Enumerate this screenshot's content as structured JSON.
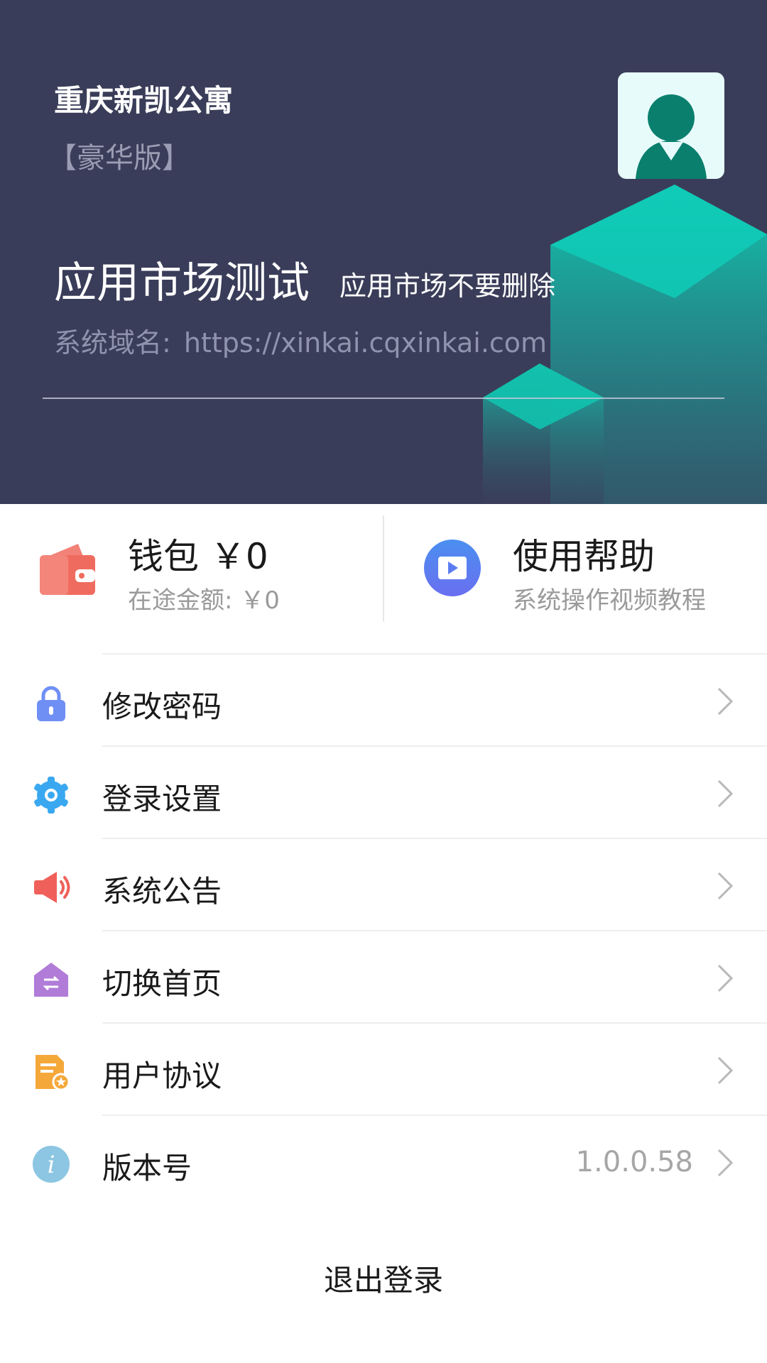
{
  "header": {
    "company": "重庆新凯公寓",
    "edition": "【豪华版】",
    "app_name": "应用市场测试",
    "app_desc": "应用市场不要删除",
    "domain_label": "系统域名:",
    "domain_url": "https://xinkai.cqxinkai.com",
    "avatar_icon": "user-avatar-icon",
    "bg_color": "#3a3d59"
  },
  "wallet": {
    "title": "钱包 ￥0",
    "subtitle": "在途金额: ￥0",
    "icon": "wallet-icon",
    "color": "#f06b5f"
  },
  "help": {
    "title": "使用帮助",
    "subtitle": "系统操作视频教程",
    "icon": "video-play-icon",
    "color": "#5c7cf0"
  },
  "menu": {
    "items": [
      {
        "label": "修改密码",
        "icon": "lock-icon",
        "color": "#6f8ff5"
      },
      {
        "label": "登录设置",
        "icon": "gear-icon",
        "color": "#3aa8f0"
      },
      {
        "label": "系统公告",
        "icon": "speaker-icon",
        "color": "#f0605a"
      },
      {
        "label": "切换首页",
        "icon": "switch-home-icon",
        "color": "#b07cd8"
      },
      {
        "label": "用户协议",
        "icon": "document-icon",
        "color": "#f5a83a"
      },
      {
        "label": "版本号",
        "icon": "info-icon",
        "color": "#8cc6e2",
        "value": "1.0.0.58"
      }
    ]
  },
  "logout_label": "退出登录"
}
